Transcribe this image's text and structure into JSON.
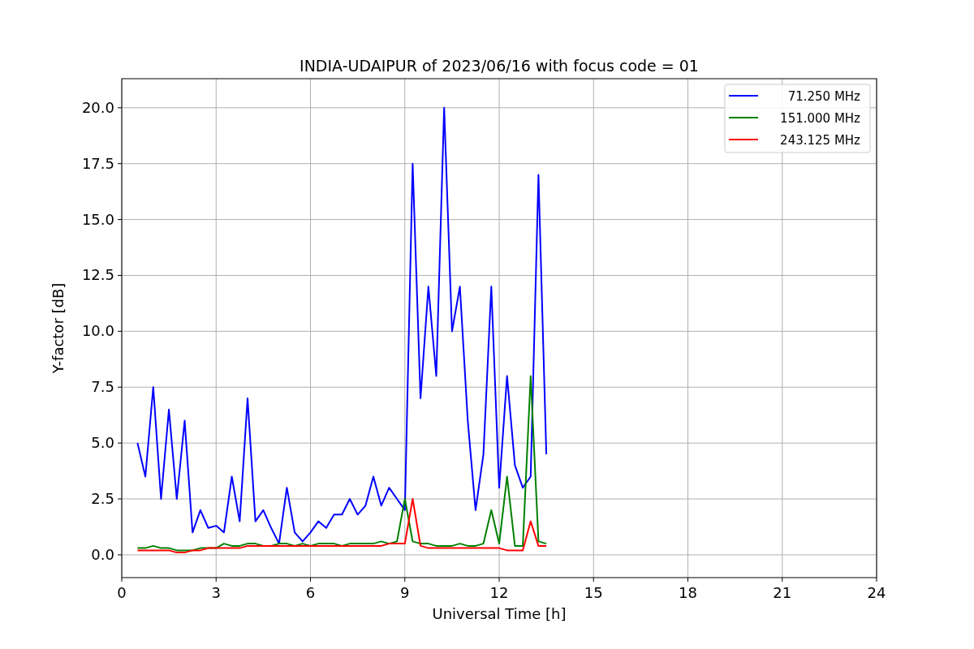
{
  "figure": {
    "chart_data": {
      "type": "line",
      "title": "INDIA-UDAIPUR of 2023/06/16 with focus code = 01",
      "xlabel": "Universal Time [h]",
      "ylabel": "Y-factor [dB]",
      "x": [
        0.5,
        0.75,
        1.0,
        1.25,
        1.5,
        1.75,
        2.0,
        2.25,
        2.5,
        2.75,
        3.0,
        3.25,
        3.5,
        3.75,
        4.0,
        4.25,
        4.5,
        4.75,
        5.0,
        5.25,
        5.5,
        5.75,
        6.0,
        6.25,
        6.5,
        6.75,
        7.0,
        7.25,
        7.5,
        7.75,
        8.0,
        8.25,
        8.5,
        8.75,
        9.0,
        9.25,
        9.5,
        9.75,
        10.0,
        10.25,
        10.5,
        10.75,
        11.0,
        11.25,
        11.5,
        11.75,
        12.0,
        12.25,
        12.5,
        12.75,
        13.0,
        13.25,
        13.5
      ],
      "series": [
        {
          "name": "71.250 MHz",
          "color": "#0000ff",
          "values": [
            5.0,
            3.5,
            7.5,
            2.5,
            6.5,
            2.5,
            6.0,
            1.0,
            2.0,
            1.2,
            1.3,
            1.0,
            3.5,
            1.5,
            7.0,
            1.5,
            2.0,
            1.2,
            0.5,
            3.0,
            1.0,
            0.6,
            1.0,
            1.5,
            1.2,
            1.8,
            1.8,
            2.5,
            1.8,
            2.2,
            3.5,
            2.2,
            3.0,
            2.5,
            2.0,
            17.5,
            7.0,
            12.0,
            8.0,
            20.0,
            10.0,
            12.0,
            6.0,
            2.0,
            4.5,
            12.0,
            3.0,
            8.0,
            4.0,
            3.0,
            3.5,
            17.0,
            4.5
          ]
        },
        {
          "name": "151.000 MHz",
          "color": "#008000",
          "values": [
            0.3,
            0.3,
            0.4,
            0.3,
            0.3,
            0.2,
            0.2,
            0.2,
            0.3,
            0.3,
            0.3,
            0.5,
            0.4,
            0.4,
            0.5,
            0.5,
            0.4,
            0.4,
            0.5,
            0.5,
            0.4,
            0.5,
            0.4,
            0.5,
            0.5,
            0.5,
            0.4,
            0.5,
            0.5,
            0.5,
            0.5,
            0.6,
            0.5,
            0.6,
            2.5,
            0.6,
            0.5,
            0.5,
            0.4,
            0.4,
            0.4,
            0.5,
            0.4,
            0.4,
            0.5,
            2.0,
            0.5,
            3.5,
            0.4,
            0.4,
            8.0,
            0.6,
            0.5
          ]
        },
        {
          "name": "243.125 MHz",
          "color": "#ff0000",
          "values": [
            0.2,
            0.2,
            0.2,
            0.2,
            0.2,
            0.1,
            0.1,
            0.2,
            0.2,
            0.3,
            0.3,
            0.3,
            0.3,
            0.3,
            0.4,
            0.4,
            0.4,
            0.4,
            0.4,
            0.4,
            0.4,
            0.4,
            0.4,
            0.4,
            0.4,
            0.4,
            0.4,
            0.4,
            0.4,
            0.4,
            0.4,
            0.4,
            0.5,
            0.5,
            0.5,
            2.5,
            0.4,
            0.3,
            0.3,
            0.3,
            0.3,
            0.3,
            0.3,
            0.3,
            0.3,
            0.3,
            0.3,
            0.2,
            0.2,
            0.2,
            1.5,
            0.4,
            0.4
          ]
        }
      ],
      "grid": true,
      "legend": true,
      "xlim": [
        0,
        24
      ],
      "ylim": [
        -1.02,
        21.3
      ],
      "xticks": [
        0,
        3,
        6,
        9,
        12,
        15,
        18,
        21,
        24
      ],
      "yticks": [
        {
          "value": 0,
          "label": "0.0"
        },
        {
          "value": 2.5,
          "label": "2.5"
        },
        {
          "value": 5,
          "label": "5.0"
        },
        {
          "value": 7.5,
          "label": "7.5"
        },
        {
          "value": 10,
          "label": "10.0"
        },
        {
          "value": 12.5,
          "label": "12.5"
        },
        {
          "value": 15,
          "label": "15.0"
        },
        {
          "value": 17.5,
          "label": "17.5"
        },
        {
          "value": 20,
          "label": "20.0"
        }
      ]
    }
  }
}
